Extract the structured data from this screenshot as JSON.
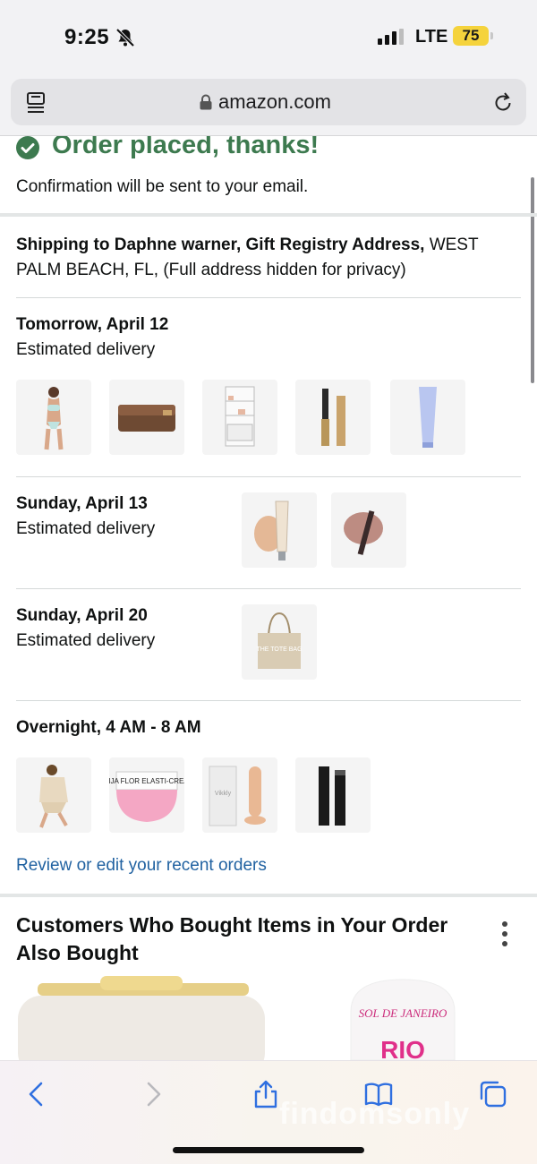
{
  "status": {
    "time": "9:25",
    "network": "LTE",
    "battery": "75"
  },
  "browser": {
    "url": "amazon.com"
  },
  "order": {
    "title": "Order placed, thanks!",
    "confirmation": "Confirmation will be sent to your email.",
    "shipping_label": "Shipping to Daphne warner, Gift Registry Address,",
    "shipping_rest": " WEST PALM BEACH, FL, (Full address hidden for privacy)"
  },
  "groups": [
    {
      "title": "Tomorrow, April 12",
      "subtitle": "Estimated delivery"
    },
    {
      "title": "Sunday, April 13",
      "subtitle": "Estimated delivery"
    },
    {
      "title": "Sunday, April 20",
      "subtitle": "Estimated delivery"
    },
    {
      "title": "Overnight, 4 AM - 8 AM"
    }
  ],
  "review_link": "Review or edit your recent orders",
  "customers_also_bought": {
    "title": "Customers Who Bought Items in Your Order Also Bought"
  },
  "product_text": {
    "tote": "THE TOTE BAG",
    "beija": "BEIJA FLOR ELASTI-CREAM",
    "vikkly": "Vikkly",
    "sol_brand": "SOL DE JANEIRO",
    "rio": "RIO"
  },
  "watermark": "findomsonly"
}
